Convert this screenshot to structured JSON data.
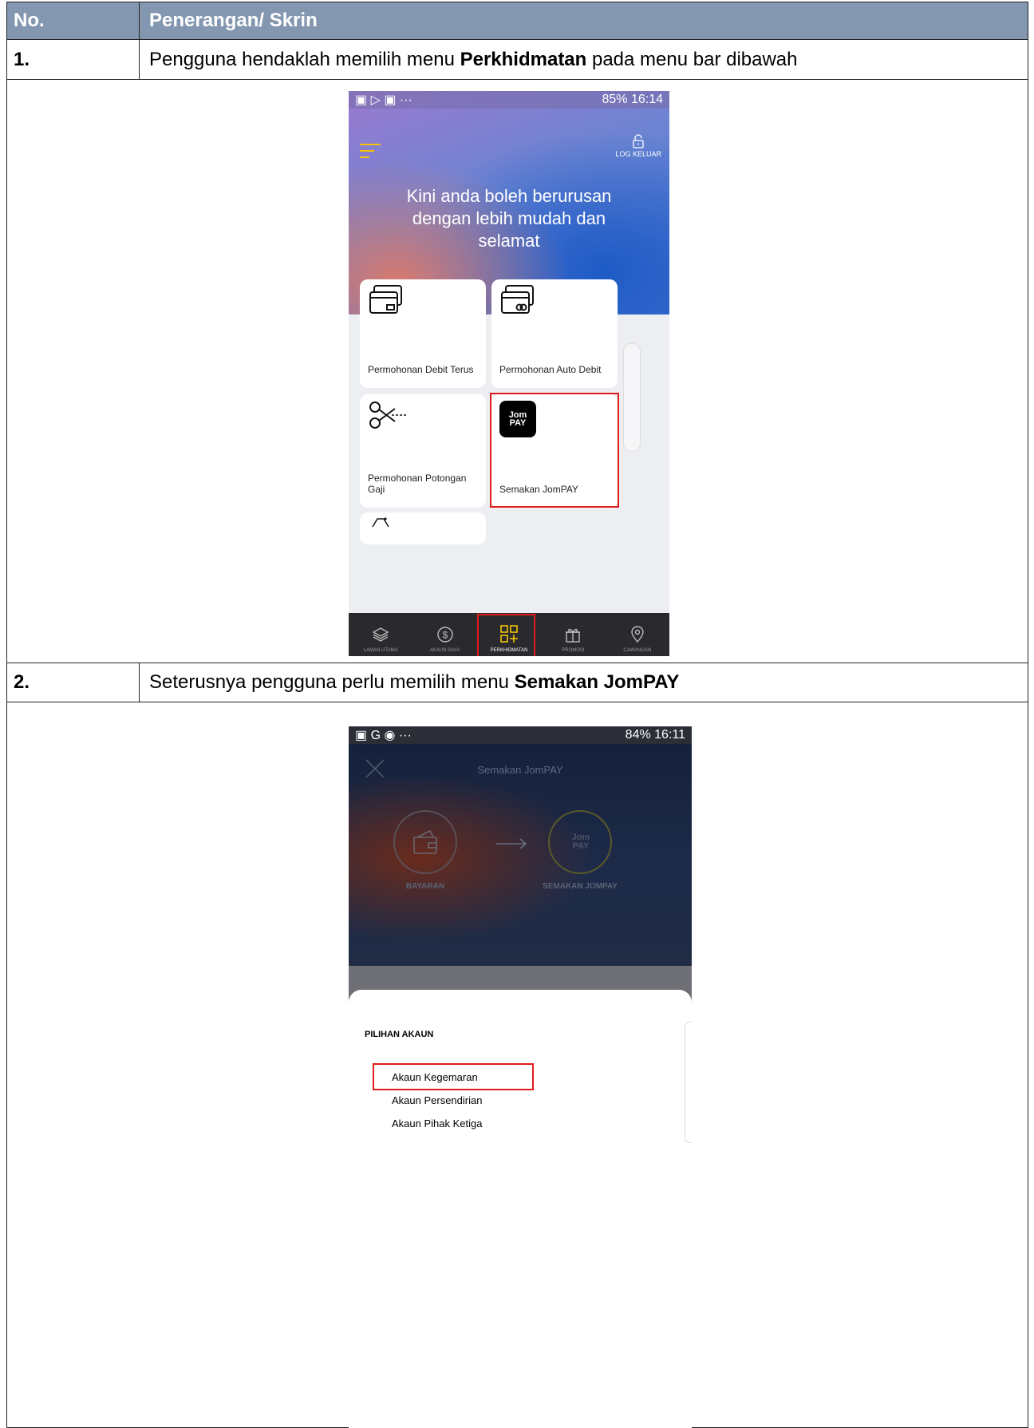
{
  "table": {
    "header": {
      "no": "No.",
      "desc": "Penerangan/ Skrin"
    },
    "steps": [
      {
        "no": "1.",
        "text_before": "Pengguna hendaklah memilih menu ",
        "bold": "Perkhidmatan",
        "text_after": " pada menu bar dibawah"
      },
      {
        "no": "2.",
        "text_before": "Seterusnya pengguna perlu memilih menu ",
        "bold": "Semakan JomPAY",
        "text_after": ""
      }
    ]
  },
  "phone1": {
    "status_right": "85% 16:14",
    "logout": "LOG KELUAR",
    "hero_lines": [
      "Kini anda boleh berurusan",
      "dengan lebih mudah dan",
      "selamat"
    ],
    "tiles": [
      {
        "label": "Permohonan Debit Terus",
        "icon": "card-icon"
      },
      {
        "label": "Permohonan Auto Debit",
        "icon": "card-coin-icon"
      },
      {
        "label": "Permohonan Potongan Gaji",
        "icon": "scissors-icon"
      },
      {
        "label": "Semakan JomPAY",
        "icon": "jompay-logo"
      }
    ],
    "nav": [
      "LAMAN UTAMA",
      "AKAUN SAYA",
      "PERKHIDMATAN",
      "PROMOSI",
      "CAWANGAN"
    ],
    "nav_active": "PERKHIDMATAN",
    "accent_color": "#f4c400",
    "highlight_color": "#e21b1b"
  },
  "phone2": {
    "status_right": "84% 16:11",
    "title": "Semakan JomPAY",
    "step_from": "BAYARAN",
    "step_to": "SEMAKAN JOMPAY",
    "sheet_title": "PILIHAN AKAUN",
    "options": [
      "Akaun Kegemaran",
      "Akaun Persendirian",
      "Akaun Pihak Ketiga"
    ],
    "selected_option": "Akaun Kegemaran"
  }
}
